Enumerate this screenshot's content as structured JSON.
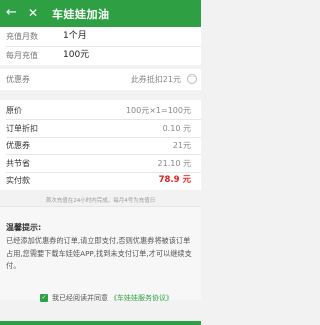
{
  "header": {
    "back_glyph": "←",
    "close_glyph": "✕",
    "title": "车娃娃加油"
  },
  "recharge": {
    "times_label": "充值月数",
    "times_value": "1个月",
    "monthly_label": "每月充值",
    "monthly_value": "100元"
  },
  "coupon": {
    "label": "优惠券",
    "value": "此券抵扣21元",
    "more_glyph": "···"
  },
  "summary": [
    {
      "label": "原价",
      "value": "100元×1=100元",
      "color": "#888888"
    },
    {
      "label": "订单折扣",
      "value": "0.10 元",
      "color": "#888888"
    },
    {
      "label": "优惠券",
      "value": "21元",
      "color": "#888888"
    },
    {
      "label": "共节省",
      "value": "21.10 元",
      "color": "#888888"
    },
    {
      "label": "实付款",
      "value": "78.9 元",
      "color": "#e0201c"
    }
  ],
  "note": "首次充值在24小时内完成，每月4号为充值日",
  "tips": {
    "title": "温馨提示:",
    "body": "已经添加优惠券的订单,请立即支付,否则优惠券将被该订单占用,您需要下载车娃娃APP,找到未支付订单,才可以继续支付。"
  },
  "agreement": {
    "checked_glyph": "✓",
    "text": "我已经阅读并同意",
    "link": "《车娃娃服务协议》"
  },
  "colors": {
    "brand": "#2ea043",
    "price": "#e0201c"
  }
}
